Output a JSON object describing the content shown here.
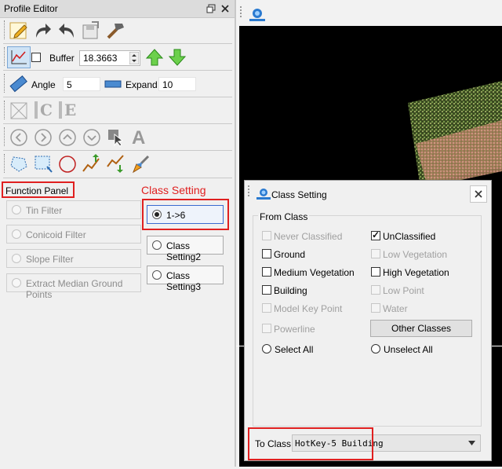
{
  "profile_editor": {
    "title": "Profile Editor",
    "buffer_label": "Buffer",
    "buffer_value": "18.3663",
    "angle_label": "Angle",
    "angle_value": "5",
    "expand_label": "Expand",
    "expand_value": "10",
    "function_panel_label": "Function Panel",
    "class_setting_annotation": "Class Setting",
    "function_buttons": [
      "Tin Filter",
      "Conicoid Filter",
      "Slope Filter",
      "Extract Median Ground Points"
    ],
    "class_buttons": [
      "1->6",
      "Class Setting2",
      "Class Setting3"
    ],
    "letter_c": "C",
    "letter_e": "E",
    "letter_a": "A"
  },
  "class_dialog": {
    "title": "Class Setting",
    "from_class_label": "From Class",
    "options": [
      {
        "label": "Never Classified",
        "checked": false,
        "enabled": false
      },
      {
        "label": "UnClassified",
        "checked": true,
        "enabled": true
      },
      {
        "label": "Ground",
        "checked": false,
        "enabled": true
      },
      {
        "label": "Low Vegetation",
        "checked": false,
        "enabled": false
      },
      {
        "label": "Medium Vegetation",
        "checked": false,
        "enabled": true
      },
      {
        "label": "High Vegetation",
        "checked": false,
        "enabled": true
      },
      {
        "label": "Building",
        "checked": false,
        "enabled": true
      },
      {
        "label": "Low Point",
        "checked": false,
        "enabled": false
      },
      {
        "label": "Model Key Point",
        "checked": false,
        "enabled": false
      },
      {
        "label": "Water",
        "checked": false,
        "enabled": false
      },
      {
        "label": "Powerline",
        "checked": false,
        "enabled": false
      }
    ],
    "other_classes_label": "Other Classes",
    "select_all_label": "Select All",
    "unselect_all_label": "Unselect All",
    "to_class_label": "To  Class:",
    "to_class_value": "HotKey-5  Building"
  },
  "colors": {
    "annotation_red": "#e02020",
    "panel_bg": "#f0f0f0"
  }
}
